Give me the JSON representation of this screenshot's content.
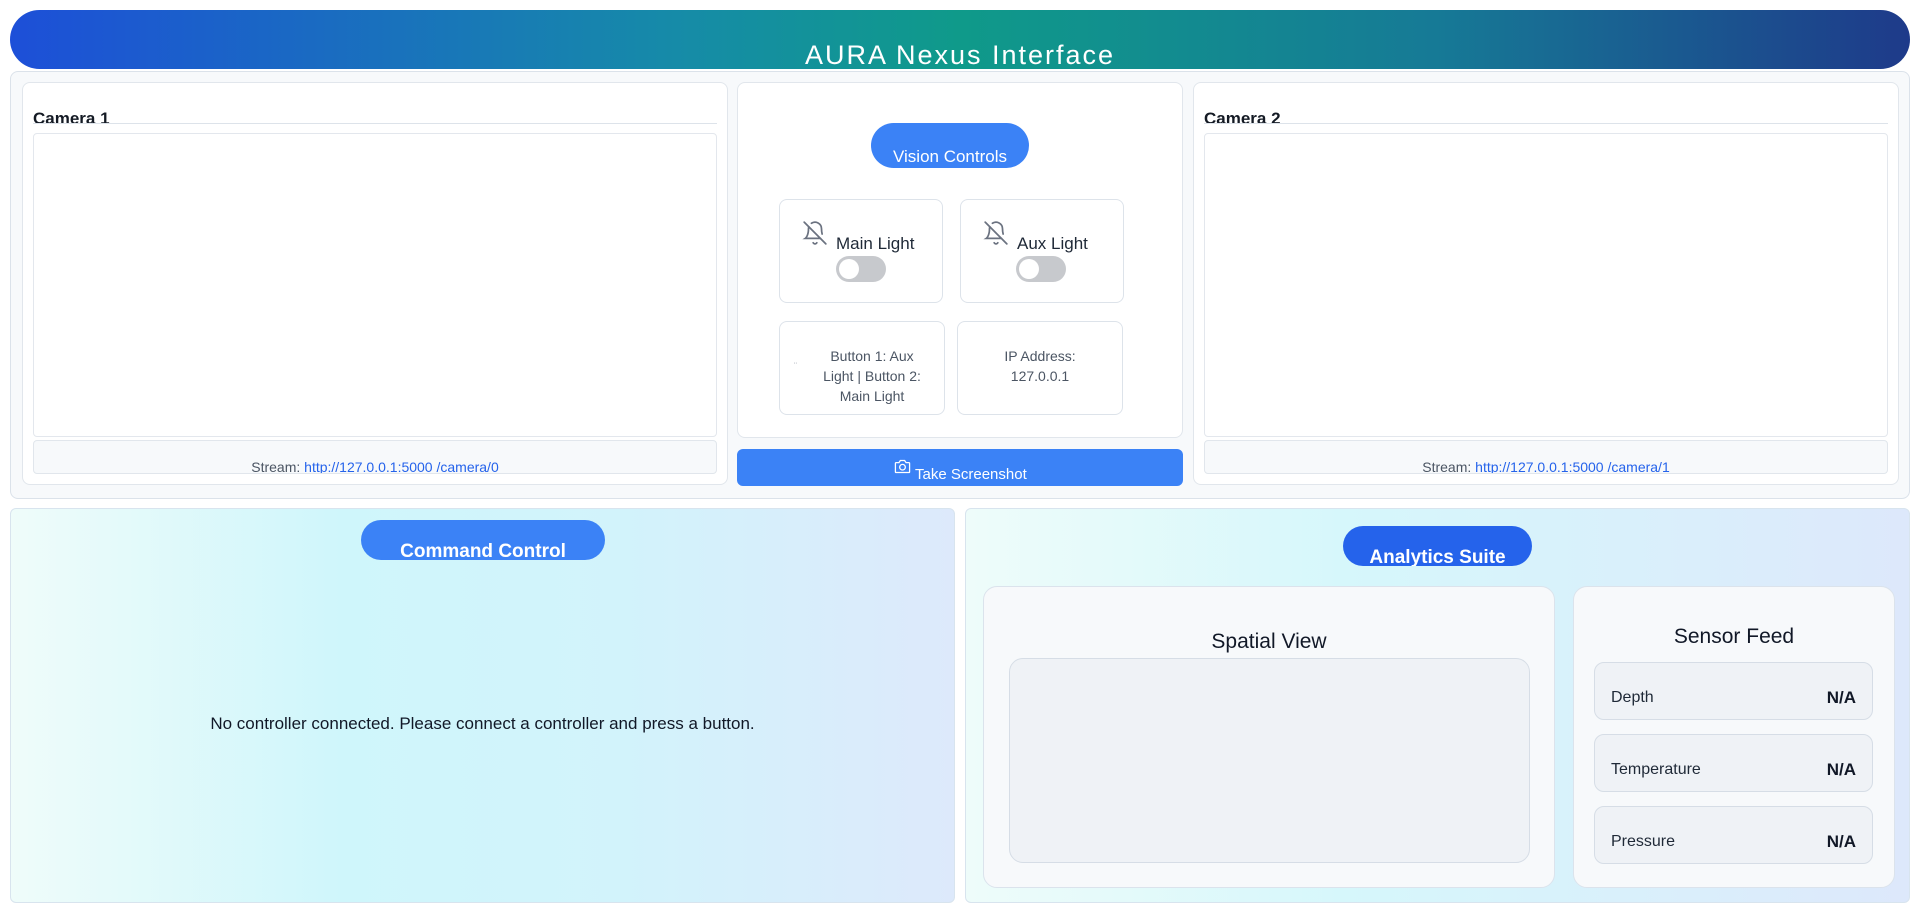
{
  "header": {
    "title": "AURA Nexus Interface"
  },
  "camera1": {
    "title": "Camera 1",
    "stream_label": "Stream:",
    "stream_url": "http://127.0.0.1:5000 /camera/0"
  },
  "camera2": {
    "title": "Camera 2",
    "stream_label": "Stream:",
    "stream_url": "http://127.0.0.1:5000 /camera/1"
  },
  "vision": {
    "title": "Vision Controls",
    "lights": [
      {
        "label": "Main Light",
        "icon": "bell-off-icon",
        "on": false
      },
      {
        "label": "Aux Light",
        "icon": "bell-off-icon",
        "on": false
      }
    ],
    "button_map_line1": "Button 1: Aux",
    "button_map_line2": "Light | Button 2:",
    "button_map_line3": "Main Light",
    "ip_label": "IP Address:",
    "ip_value": "127.0.0.1",
    "screenshot_label": "Take Screenshot",
    "screenshot_icon": "camera-icon"
  },
  "command": {
    "title": "Command Control",
    "message": "No controller connected. Please connect a controller and press a button."
  },
  "analytics": {
    "title": "Analytics Suite",
    "spatial_title": "Spatial View",
    "sensor_title": "Sensor Feed",
    "sensors": [
      {
        "label": "Depth",
        "value": "N/A"
      },
      {
        "label": "Temperature",
        "value": "N/A"
      },
      {
        "label": "Pressure",
        "value": "N/A"
      }
    ]
  },
  "colors": {
    "accent": "#3b82f6",
    "accent_dark": "#2563eb",
    "header_start": "#1d4fd8",
    "header_mid": "#0f9a8a",
    "header_end": "#1e3a8a"
  }
}
